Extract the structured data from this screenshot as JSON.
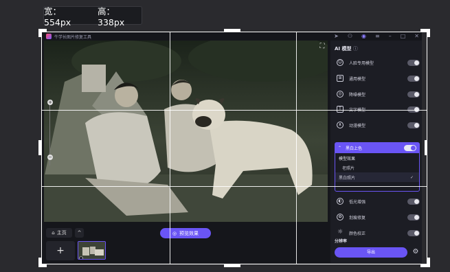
{
  "size_tip": {
    "width_label": "宽：554px",
    "height_label": "高：338px"
  },
  "titlebar": {
    "app_title": "牛学长图片修复工具",
    "icons": [
      "send-icon",
      "link-icon",
      "user-icon",
      "menu-icon",
      "minimize-icon",
      "maximize-icon",
      "close-icon"
    ]
  },
  "canvas": {
    "crop_icon": "crop-expand-icon",
    "zoom_in": "+",
    "zoom_out": "−"
  },
  "bottombar": {
    "home_label": "主页",
    "up_label": "^",
    "preview_label": "预览效果",
    "add_label": "+"
  },
  "panel": {
    "title": "AI 模型",
    "models": [
      {
        "label": "人脸专用模型",
        "icon": "face-icon",
        "on": false
      },
      {
        "label": "通用模型",
        "icon": "general-icon",
        "on": false
      },
      {
        "label": "降噪模型",
        "icon": "denoise-icon",
        "on": false
      },
      {
        "label": "文字模型",
        "icon": "text-icon",
        "on": false
      },
      {
        "label": "动漫模型",
        "icon": "anime-icon",
        "on": false
      }
    ],
    "colorize": {
      "label": "黑白上色",
      "on": true,
      "options_header": "模型效果",
      "options": [
        "老照片",
        "黑白照片"
      ],
      "selected": "黑白照片"
    },
    "extras": [
      {
        "label": "低光增强",
        "icon": "contrast-icon",
        "on": false
      },
      {
        "label": "划痕修复",
        "icon": "scratch-icon",
        "on": false
      },
      {
        "label": "颜色校正",
        "icon": "sun-icon",
        "on": false
      }
    ],
    "resolution_label": "分辨率",
    "export_label": "导出",
    "settings_icon": "gear-icon"
  },
  "colors": {
    "accent": "#6a55f5",
    "bg": "#15161b",
    "panel": "#1c1d24"
  }
}
